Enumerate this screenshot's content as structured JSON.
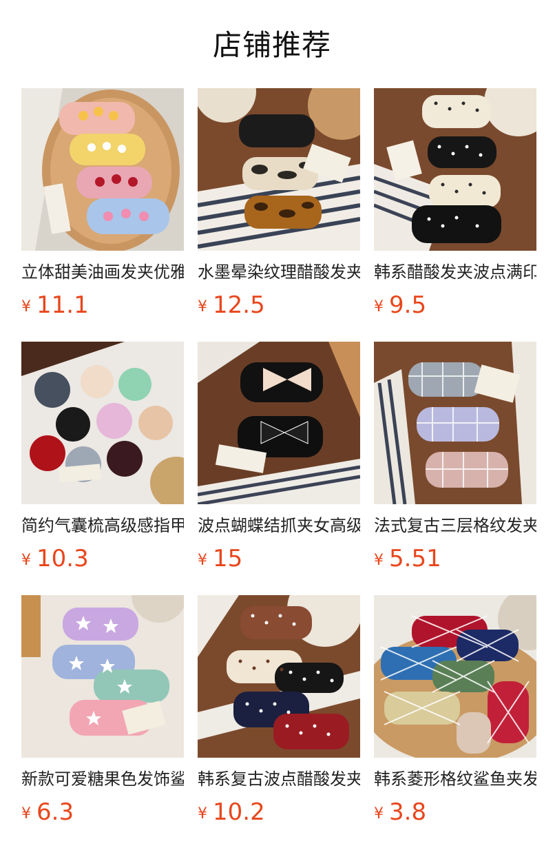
{
  "page": {
    "title": "店铺推荐"
  },
  "colors": {
    "price": "#e8461c",
    "text": "#222222"
  },
  "products": [
    {
      "name": "立体甜美油画发夹优雅",
      "currency": "¥",
      "price": "11.1",
      "image": "stacked-flower-hair-claws"
    },
    {
      "name": "水墨晕染纹理醋酸发夹",
      "currency": "¥",
      "price": "12.5",
      "image": "ink-marble-hair-claws"
    },
    {
      "name": "韩系醋酸发夹波点满印",
      "currency": "¥",
      "price": "9.5",
      "image": "polka-dot-bow-hair-claws"
    },
    {
      "name": "简约气囊梳高级感指甲",
      "currency": "¥",
      "price": "10.3",
      "image": "round-cushion-combs"
    },
    {
      "name": "波点蝴蝶结抓夹女高级",
      "currency": "¥",
      "price": "15",
      "image": "polka-bow-hair-claws"
    },
    {
      "name": "法式复古三层格纹发夹",
      "currency": "¥",
      "price": "5.51",
      "image": "plaid-hair-claws"
    },
    {
      "name": "新款可爱糖果色发饰鲨",
      "currency": "¥",
      "price": "6.3",
      "image": "star-candy-hair-claws"
    },
    {
      "name": "韩系复古波点醋酸发夹",
      "currency": "¥",
      "price": "10.2",
      "image": "retro-dot-hair-claws"
    },
    {
      "name": "韩系菱形格纹鲨鱼夹发",
      "currency": "¥",
      "price": "3.8",
      "image": "argyle-shark-clips"
    }
  ]
}
